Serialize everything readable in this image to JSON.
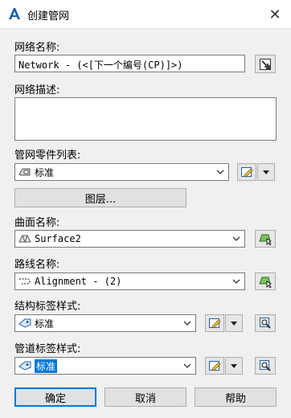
{
  "window": {
    "title": "创建管网",
    "close_glyph": "✕"
  },
  "network_name": {
    "label": "网络名称:",
    "value": "Network - (<[下一个编号(CP)]>)"
  },
  "network_description": {
    "label": "网络描述:",
    "value": ""
  },
  "parts_list": {
    "label": "管网零件列表:",
    "selected": "标准"
  },
  "layers_button": {
    "label": "图层..."
  },
  "surface_name": {
    "label": "曲面名称:",
    "selected": "Surface2"
  },
  "alignment_name": {
    "label": "路线名称:",
    "selected": "Alignment - (2)"
  },
  "structure_label_style": {
    "label": "结构标签样式:",
    "selected": "标准"
  },
  "pipe_label_style": {
    "label": "管道标签样式:",
    "selected": "标准"
  },
  "buttons": {
    "ok": "确定",
    "cancel": "取消",
    "help": "帮助"
  },
  "colors": {
    "accent": "#0078d7",
    "background": "#f0f0f0"
  }
}
